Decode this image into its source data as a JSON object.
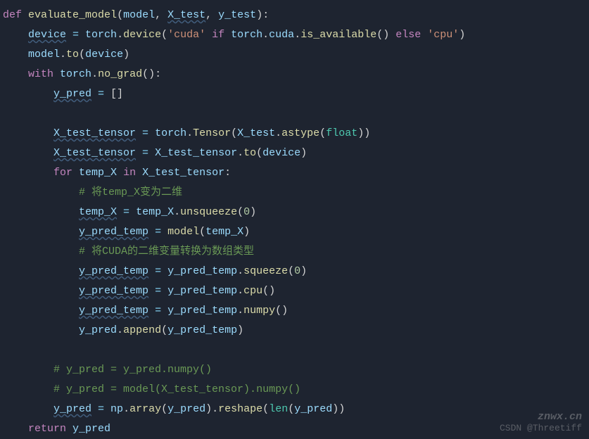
{
  "code": {
    "l1": {
      "def": "def",
      "fname": "evaluate_model",
      "lp": "(",
      "model": "model",
      "c1": ",",
      "sp": " ",
      "xtest": "X_test",
      "c2": ",",
      "ytest": "y_test",
      "rp": ")",
      "colon": ":"
    },
    "l2": {
      "device": "device",
      "eq": " = ",
      "torch": "torch",
      "dot": ".",
      "devfn": "device",
      "lp": "(",
      "s1": "'cuda'",
      "if": " if ",
      "torch2": "torch",
      "cuda": "cuda",
      "avail": "is_available",
      "lprp": "()",
      "else": " else ",
      "s2": "'cpu'",
      "rp": ")"
    },
    "l3": {
      "model": "model",
      "dot": ".",
      "to": "to",
      "lp": "(",
      "device": "device",
      "rp": ")"
    },
    "l4": {
      "with": "with",
      "sp": " ",
      "torch": "torch",
      "dot": ".",
      "nograd": "no_grad",
      "lprp": "()",
      "colon": ":"
    },
    "l5": {
      "ypred": "y_pred",
      "eq": " = ",
      "list": "[]"
    },
    "l6": {
      "xtt": "X_test_tensor",
      "eq": " = ",
      "torch": "torch",
      "dot": ".",
      "tensor": "Tensor",
      "lp": "(",
      "xtest": "X_test",
      "dot2": ".",
      "astype": "astype",
      "lp2": "(",
      "float": "float",
      "rp2": ")",
      "rp": ")"
    },
    "l7": {
      "xtt": "X_test_tensor",
      "eq": " = ",
      "xtt2": "X_test_tensor",
      "dot": ".",
      "to": "to",
      "lp": "(",
      "device": "device",
      "rp": ")"
    },
    "l8": {
      "for": "for",
      "sp": " ",
      "tempx": "temp_X",
      "sp2": " ",
      "in": "in",
      "sp3": " ",
      "xtt": "X_test_tensor",
      "colon": ":"
    },
    "l9": {
      "comment": "# 将temp_X变为二维"
    },
    "l10": {
      "tempx": "temp_X",
      "eq": " = ",
      "tempx2": "temp_X",
      "dot": ".",
      "unsq": "unsqueeze",
      "lp": "(",
      "zero": "0",
      "rp": ")"
    },
    "l11": {
      "ypt": "y_pred_temp",
      "eq": " = ",
      "model": "model",
      "lp": "(",
      "tempx": "temp_X",
      "rp": ")"
    },
    "l12": {
      "comment": "# 将CUDA的二维变量转换为数组类型"
    },
    "l13": {
      "ypt": "y_pred_temp",
      "eq": " = ",
      "ypt2": "y_pred_temp",
      "dot": ".",
      "sq": "squeeze",
      "lp": "(",
      "zero": "0",
      "rp": ")"
    },
    "l14": {
      "ypt": "y_pred_temp",
      "eq": " = ",
      "ypt2": "y_pred_temp",
      "dot": ".",
      "cpu": "cpu",
      "lprp": "()"
    },
    "l15": {
      "ypt": "y_pred_temp",
      "eq": " = ",
      "ypt2": "y_pred_temp",
      "dot": ".",
      "numpy": "numpy",
      "lprp": "()"
    },
    "l16": {
      "ypred": "y_pred",
      "dot": ".",
      "append": "append",
      "lp": "(",
      "ypt": "y_pred_temp",
      "rp": ")"
    },
    "l17": {
      "comment": "# y_pred = y_pred.numpy()"
    },
    "l18": {
      "comment": "# y_pred = model(X_test_tensor).numpy()"
    },
    "l19": {
      "ypred": "y_pred",
      "eq": " = ",
      "np": "np",
      "dot": ".",
      "array": "array",
      "lp": "(",
      "ypred2": "y_pred",
      "rp": ")",
      "dot2": ".",
      "reshape": "reshape",
      "lp2": "(",
      "len": "len",
      "lp3": "(",
      "ypred3": "y_pred",
      "rp3": ")",
      "rp2": ")"
    },
    "l20": {
      "return": "return",
      "sp": " ",
      "ypred": "y_pred"
    }
  },
  "watermark": {
    "top": "znwx.cn",
    "bottom": "CSDN @Threetiff"
  }
}
